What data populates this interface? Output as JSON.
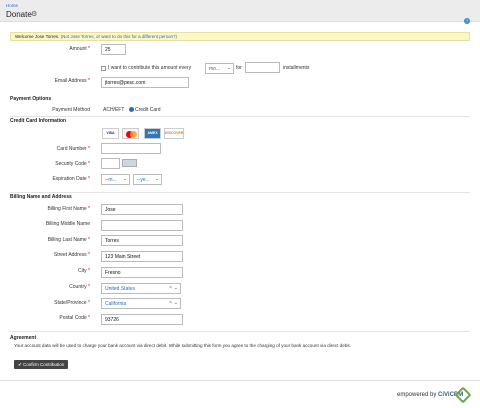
{
  "breadcrumb": "Home",
  "title": "Donate",
  "welcome": {
    "text": "Welcome Jose Torres.",
    "link": "(Not Jose Torres, or want to do this for a different person?)"
  },
  "amount": {
    "label": "Amount",
    "value": "25"
  },
  "installments": {
    "prefix": "I want to contribute this amount every",
    "unit_value": "mo...",
    "for_label": "for",
    "count_value": "",
    "suffix": "installments"
  },
  "email": {
    "label": "Email Address",
    "value": "jtorres@pesc.com"
  },
  "payment_options": {
    "heading": "Payment Options",
    "method_label": "Payment Method",
    "option1": "ACH/EFT",
    "option2": "Credit Card"
  },
  "credit_card": {
    "heading": "Credit Card Information",
    "cards": [
      "VISA",
      "MC",
      "AMEX",
      "DISCOVER"
    ],
    "number_label": "Card Number",
    "number_value": "",
    "security_label": "Security Code",
    "security_value": "",
    "expiration_label": "Expiration Date",
    "exp_month": "--m...",
    "exp_year": "--ye..."
  },
  "billing": {
    "heading": "Billing Name and Address",
    "first_name_label": "Billing First Name",
    "first_name": "Jose",
    "middle_name_label": "Billing Middle Name",
    "middle_name": "",
    "last_name_label": "Billing Last Name",
    "last_name": "Torres",
    "street_label": "Street Address",
    "street": "123 Main Street",
    "city_label": "City",
    "city": "Fresno",
    "country_label": "Country",
    "country": "United States",
    "state_label": "State/Province",
    "state": "California",
    "postal_label": "Postal Code",
    "postal": "93726"
  },
  "agreement": {
    "heading": "Agreement",
    "text": "Your account data will be used to charge your bank account via direct debit. While submitting this form you agree to the charging of your bank account via direct debit."
  },
  "confirm_button": "Confirm Contribution",
  "footer": {
    "powered": "empowered by",
    "brand": "CiViCRM"
  },
  "colors": {
    "link": "#2a6ebb",
    "required": "#cc0000",
    "button": "#444444",
    "notice_bg": "#fbf7c7"
  }
}
